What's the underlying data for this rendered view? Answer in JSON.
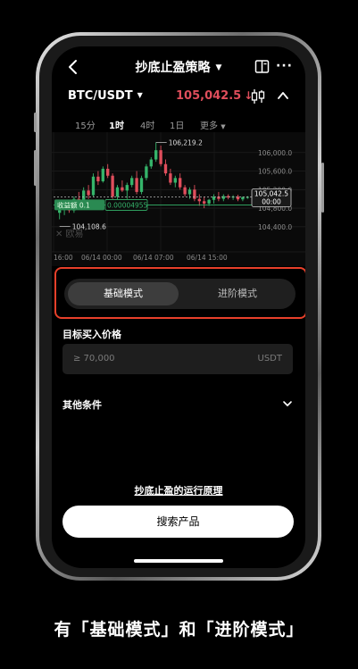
{
  "header": {
    "title": "抄底止盈策略",
    "back_icon": "back-arrow-icon",
    "guide_icon": "book-icon",
    "more_icon": "more-dots-icon"
  },
  "ticker": {
    "pair": "BTC/USDT",
    "price": "105,042.5",
    "price_direction_arrow": "↓",
    "price_color": "#e04e5c",
    "chart_toggle_icon": "candlestick-icon",
    "collapse_icon": "chevron-up-icon"
  },
  "timeframes": {
    "items": [
      "15分",
      "1时",
      "4时",
      "1日",
      "更多"
    ],
    "active": "1时"
  },
  "chart_data": {
    "type": "candlestick",
    "y_ticks": [
      "106,000.0",
      "105,600.0",
      "105,200.0",
      "104,800.0",
      "104,400.0"
    ],
    "ylim": [
      104050,
      106400
    ],
    "x_ticks": [
      "16:00",
      "06/14 00:00",
      "06/14 07:00",
      "06/14 15:00"
    ],
    "high_label": "106,219.2",
    "low_label": "104,108.6",
    "current_price_label": "105,042.5",
    "countdown": "00:00",
    "profit_label": "收益额 0.1",
    "profit_value": "0.00004955",
    "watermark": "欧易",
    "up_color": "#35b46a",
    "down_color": "#e04e5c",
    "candles": [
      {
        "o": 104700,
        "h": 104850,
        "l": 104560,
        "c": 104760
      },
      {
        "o": 104760,
        "h": 104900,
        "l": 104650,
        "c": 104830
      },
      {
        "o": 104830,
        "h": 104980,
        "l": 104700,
        "c": 104750
      },
      {
        "o": 104750,
        "h": 105050,
        "l": 104700,
        "c": 105000
      },
      {
        "o": 105000,
        "h": 105150,
        "l": 104880,
        "c": 104950
      },
      {
        "o": 104950,
        "h": 105250,
        "l": 104900,
        "c": 105180
      },
      {
        "o": 105180,
        "h": 105300,
        "l": 105000,
        "c": 105080
      },
      {
        "o": 105080,
        "h": 105550,
        "l": 105050,
        "c": 105480
      },
      {
        "o": 105480,
        "h": 105600,
        "l": 105300,
        "c": 105380
      },
      {
        "o": 105380,
        "h": 105700,
        "l": 105350,
        "c": 105650
      },
      {
        "o": 105650,
        "h": 105750,
        "l": 105450,
        "c": 105500
      },
      {
        "o": 105500,
        "h": 105550,
        "l": 105000,
        "c": 105050
      },
      {
        "o": 105050,
        "h": 105300,
        "l": 104950,
        "c": 105250
      },
      {
        "o": 105250,
        "h": 105400,
        "l": 105150,
        "c": 105180
      },
      {
        "o": 105180,
        "h": 105350,
        "l": 105000,
        "c": 105300
      },
      {
        "o": 105300,
        "h": 105500,
        "l": 105250,
        "c": 105450
      },
      {
        "o": 105450,
        "h": 105600,
        "l": 105100,
        "c": 105150
      },
      {
        "o": 105150,
        "h": 105500,
        "l": 105100,
        "c": 105450
      },
      {
        "o": 105450,
        "h": 105750,
        "l": 105400,
        "c": 105700
      },
      {
        "o": 105700,
        "h": 105900,
        "l": 105650,
        "c": 105850
      },
      {
        "o": 105850,
        "h": 106219,
        "l": 105800,
        "c": 106050
      },
      {
        "o": 106050,
        "h": 106150,
        "l": 105700,
        "c": 105750
      },
      {
        "o": 105750,
        "h": 105850,
        "l": 105500,
        "c": 105550
      },
      {
        "o": 105550,
        "h": 105650,
        "l": 105300,
        "c": 105350
      },
      {
        "o": 105350,
        "h": 105500,
        "l": 105250,
        "c": 105450
      },
      {
        "o": 105450,
        "h": 105550,
        "l": 105200,
        "c": 105250
      },
      {
        "o": 105250,
        "h": 105300,
        "l": 105050,
        "c": 105100
      },
      {
        "o": 105100,
        "h": 105250,
        "l": 105000,
        "c": 105200
      },
      {
        "o": 105200,
        "h": 105300,
        "l": 104950,
        "c": 105000
      },
      {
        "o": 105000,
        "h": 105100,
        "l": 104850,
        "c": 104950
      },
      {
        "o": 104950,
        "h": 105050,
        "l": 104800,
        "c": 104900
      },
      {
        "o": 104900,
        "h": 105000,
        "l": 104850,
        "c": 104980
      },
      {
        "o": 104980,
        "h": 105100,
        "l": 104900,
        "c": 105050
      },
      {
        "o": 105050,
        "h": 105150,
        "l": 104950,
        "c": 105000
      },
      {
        "o": 105000,
        "h": 105100,
        "l": 104950,
        "c": 105060
      },
      {
        "o": 105060,
        "h": 105100,
        "l": 104990,
        "c": 105030
      },
      {
        "o": 105030,
        "h": 105080,
        "l": 104980,
        "c": 105050
      },
      {
        "o": 105050,
        "h": 105090,
        "l": 104950,
        "c": 104990
      },
      {
        "o": 104990,
        "h": 105050,
        "l": 104950,
        "c": 105040
      },
      {
        "o": 105040,
        "h": 105060,
        "l": 105000,
        "c": 105042.5
      }
    ]
  },
  "mode_switch": {
    "basic_label": "基础模式",
    "advanced_label": "进阶模式",
    "selected": "basic",
    "highlight_color": "#e8402a"
  },
  "target_price": {
    "label": "目标买入价格",
    "placeholder": "≥ 70,000",
    "unit": "USDT"
  },
  "other_conditions": {
    "label": "其他条件",
    "icon": "chevron-down-icon"
  },
  "principle_link": "抄底止盈的运行原理",
  "search_button": "搜索产品",
  "caption": "有「基础模式」和「进阶模式」"
}
